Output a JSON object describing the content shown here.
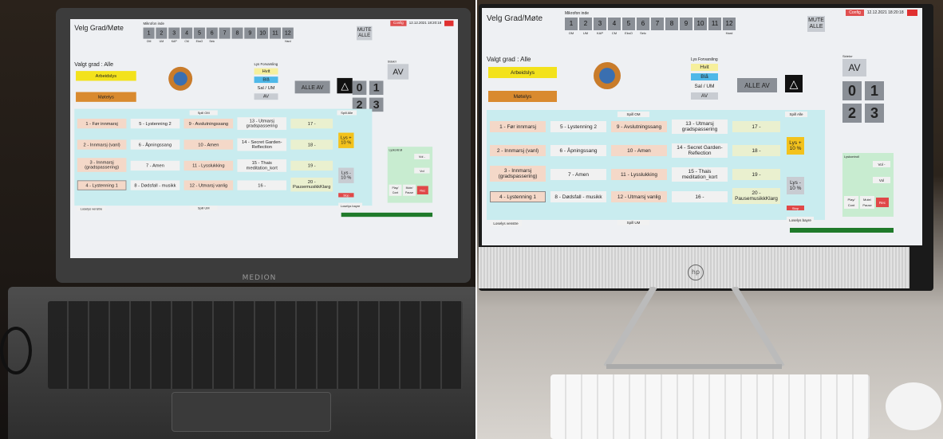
{
  "app": {
    "title": "Velg Grad/Møte",
    "mikrofon_label": "Mikrofon inde",
    "mics": [
      "1",
      "2",
      "3",
      "4",
      "5",
      "6",
      "7",
      "8",
      "9",
      "10",
      "11",
      "12"
    ],
    "mic_sub": [
      "OM",
      "UM",
      "KAP",
      "CM",
      "EksO",
      "Selc",
      "",
      "",
      "",
      "",
      "",
      "Hard"
    ],
    "mute_label": "MUTE ALLE",
    "config_label": "Config",
    "datetime": "12.12.2021 18:20:18",
    "valgt_grad": "Valgt grad : Alle",
    "arbeidslys": "Arbeidslys",
    "motelys": "Møtelys",
    "lys_forvarsling": "Lys Forvarsling",
    "hvit": "Hvit",
    "bla": "Blå",
    "sal_um": "Sal / UM",
    "av": "AV",
    "alle_av": "ALLE AV",
    "sidebar_label": "Sidekrr",
    "av_big": "AV",
    "num": [
      "0",
      "1",
      "2",
      "3"
    ],
    "spill_om": "Spill OM",
    "spill_alle": "Spill Alle",
    "spill_um": "Spill UM",
    "tracks": [
      [
        "1 - Før innmarsj",
        "5 - Lystenning 2",
        "9 - Avslutningssang",
        "13 - Utmarsj gradspassering",
        "17 -"
      ],
      [
        "2 - Innmarsj (vanl)",
        "6 - Åpningssang",
        "10 - Amen",
        "14 - Secret Garden-Reflection",
        "18 -"
      ],
      [
        "3 - Innmarsj (gradspassering)",
        "7 - Amen",
        "11 - Lysslukking",
        "15 - Thais meditation_kort",
        "19 -"
      ],
      [
        "4 - Lystenning 1",
        "8 - Dødsfall - musikk",
        "12 - Utmarsj vanlig",
        "16 -",
        "20 - PausemusikkKlarg"
      ]
    ],
    "lys_plus": "Lys + 10 %",
    "lys_minus": "Lys - 10 %",
    "lyskontroll": "Lyskontroll",
    "vol_minus": "Vol -",
    "vol_plus": "Vol",
    "play_cont": "Play/ Cont",
    "mute_pause": "Mute/ Pause",
    "rec": "Rec",
    "losslys_bayre": "Loselys bayre",
    "losslys_venstre": "Loselys venstre",
    "stop": "Stop"
  },
  "hardware": {
    "laptop_brand": "MEDION",
    "monitor_logo": "hp"
  }
}
